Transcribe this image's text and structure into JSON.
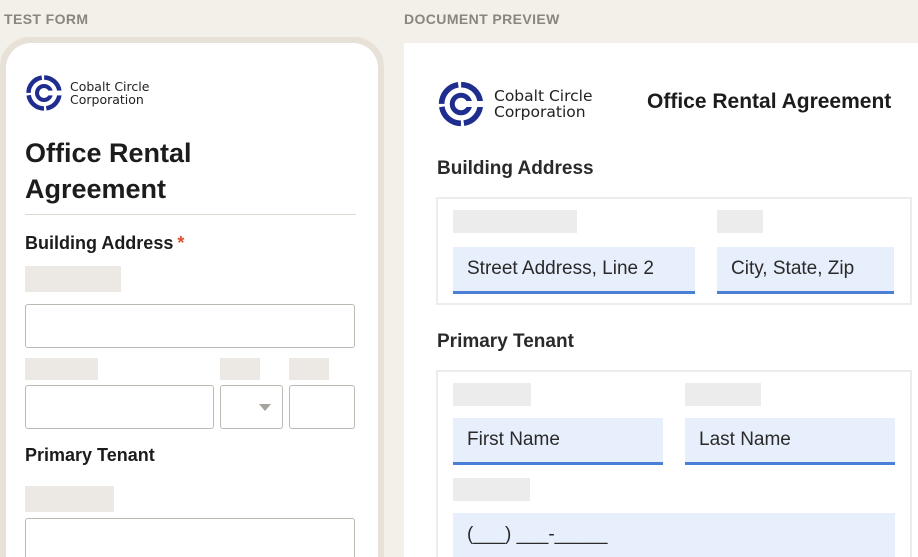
{
  "sections": {
    "test_form_label": "TEST FORM",
    "document_preview_label": "DOCUMENT PREVIEW"
  },
  "brand": {
    "line1": "Cobalt Circle",
    "line2": "Corporation",
    "logo_icon": "cobalt-circle-logo",
    "logo_color": "#1f2d8f",
    "accent_color": "#4a7fd6"
  },
  "form": {
    "title": "Office Rental Agreement",
    "building_address_heading": "Building Address",
    "required_marker": "*",
    "primary_tenant_heading": "Primary Tenant"
  },
  "preview": {
    "title": "Office Rental Agreement",
    "building_address_heading": "Building Address",
    "street_line2_placeholder": "Street Address, Line 2",
    "city_state_zip_placeholder": "City, State, Zip",
    "primary_tenant_heading": "Primary Tenant",
    "first_name_placeholder": "First Name",
    "last_name_placeholder": "Last Name",
    "phone_placeholder": "(___) ___-_____"
  }
}
